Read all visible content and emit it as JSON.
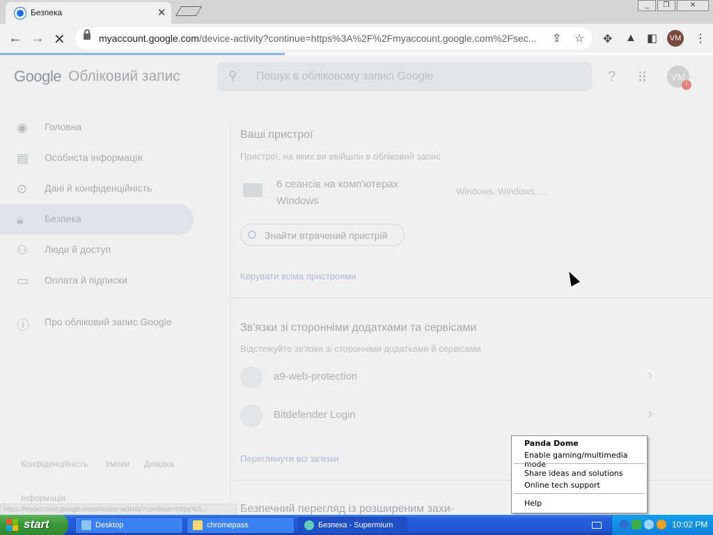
{
  "browser": {
    "tab_title": "Безпека",
    "url_host": "myaccount.google.com",
    "url_rest": "/device-activity?continue=https%3A%2F%2Fmyaccount.google.com%2Fsec...",
    "window_buttons": [
      "_",
      "❐",
      "✕"
    ],
    "profile_initials": "VM"
  },
  "header": {
    "logo": "Google",
    "title": "Обліковий запис",
    "search_placeholder": "Пошук в обліковому записі Google",
    "avatar_initials": "VM"
  },
  "sidebar": {
    "items": [
      {
        "label": "Головна",
        "icon": "home-icon"
      },
      {
        "label": "Особиста інформація",
        "icon": "id-card-icon"
      },
      {
        "label": "Дані й конфіденційність",
        "icon": "toggle-icon"
      },
      {
        "label": "Безпека",
        "icon": "lock-icon"
      },
      {
        "label": "Люди й доступ",
        "icon": "people-icon"
      },
      {
        "label": "Оплата й підписки",
        "icon": "card-icon"
      },
      {
        "label": "Про обліковий запис Google",
        "icon": "info-icon"
      }
    ],
    "footer": [
      "Конфіденційність",
      "Умови",
      "Довідка"
    ],
    "info_label": "Інформація"
  },
  "devices": {
    "heading": "Ваші пристрої",
    "subtitle": "Пристрої, на яких ви ввійшли в обліковий запис",
    "row_title": "6 сеансів на комп'ютерах Windows",
    "row_os": "Windows, Windows, ...",
    "find_button": "Знайти втрачений пристрій",
    "manage_link": "Керувати всіма пристроями"
  },
  "connections": {
    "heading": "Зв'язки зі сторонніми додатками та сервісами",
    "subtitle": "Відстежуйте зв'язки зі сторонніми додатками й сервісами",
    "items": [
      "a9-web-protection",
      "Bitdefender Login"
    ],
    "view_all": "Переглянути всі зв'язки"
  },
  "next_section_heading": "Безпечний перегляд із розширеним захи-",
  "status_url": "https://myaccount.google.com/device-activity?continue=https%3...",
  "context_menu": {
    "title": "Panda Dome",
    "items": [
      "Enable gaming/multimedia mode",
      "Share ideas and solutions",
      "Online tech support",
      "Help"
    ]
  },
  "taskbar": {
    "start": "start",
    "tasks": [
      "Desktop",
      "chromepass",
      "Безпека - Supermium"
    ],
    "clock": "10:02 PM"
  }
}
